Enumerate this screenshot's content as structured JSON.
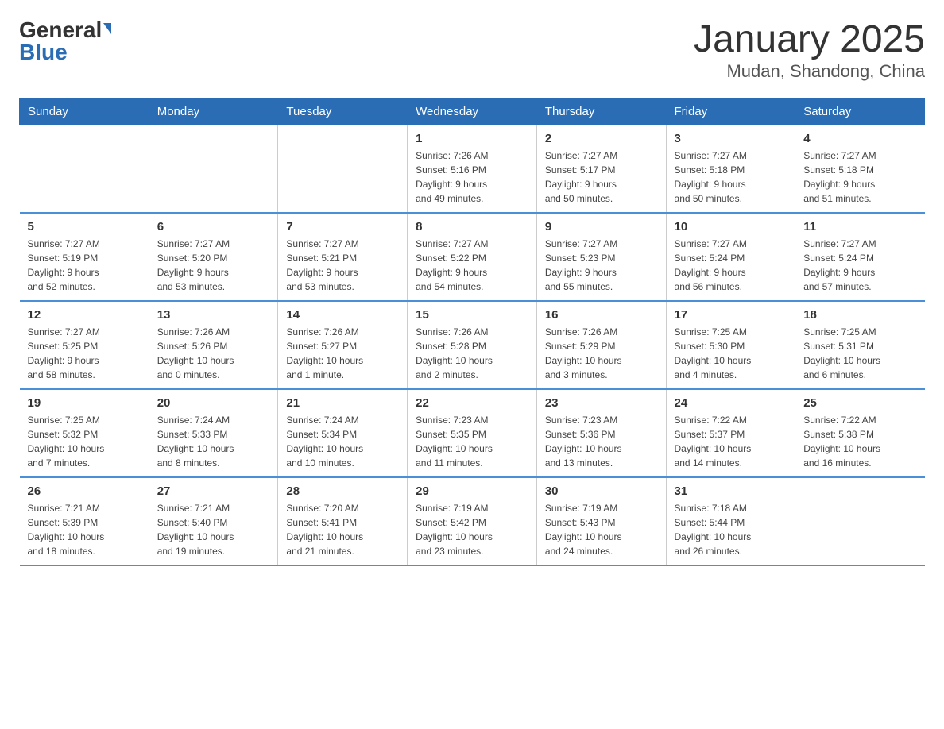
{
  "logo": {
    "general": "General",
    "blue": "Blue"
  },
  "title": "January 2025",
  "subtitle": "Mudan, Shandong, China",
  "weekdays": [
    "Sunday",
    "Monday",
    "Tuesday",
    "Wednesday",
    "Thursday",
    "Friday",
    "Saturday"
  ],
  "weeks": [
    [
      {
        "day": "",
        "info": ""
      },
      {
        "day": "",
        "info": ""
      },
      {
        "day": "",
        "info": ""
      },
      {
        "day": "1",
        "info": "Sunrise: 7:26 AM\nSunset: 5:16 PM\nDaylight: 9 hours\nand 49 minutes."
      },
      {
        "day": "2",
        "info": "Sunrise: 7:27 AM\nSunset: 5:17 PM\nDaylight: 9 hours\nand 50 minutes."
      },
      {
        "day": "3",
        "info": "Sunrise: 7:27 AM\nSunset: 5:18 PM\nDaylight: 9 hours\nand 50 minutes."
      },
      {
        "day": "4",
        "info": "Sunrise: 7:27 AM\nSunset: 5:18 PM\nDaylight: 9 hours\nand 51 minutes."
      }
    ],
    [
      {
        "day": "5",
        "info": "Sunrise: 7:27 AM\nSunset: 5:19 PM\nDaylight: 9 hours\nand 52 minutes."
      },
      {
        "day": "6",
        "info": "Sunrise: 7:27 AM\nSunset: 5:20 PM\nDaylight: 9 hours\nand 53 minutes."
      },
      {
        "day": "7",
        "info": "Sunrise: 7:27 AM\nSunset: 5:21 PM\nDaylight: 9 hours\nand 53 minutes."
      },
      {
        "day": "8",
        "info": "Sunrise: 7:27 AM\nSunset: 5:22 PM\nDaylight: 9 hours\nand 54 minutes."
      },
      {
        "day": "9",
        "info": "Sunrise: 7:27 AM\nSunset: 5:23 PM\nDaylight: 9 hours\nand 55 minutes."
      },
      {
        "day": "10",
        "info": "Sunrise: 7:27 AM\nSunset: 5:24 PM\nDaylight: 9 hours\nand 56 minutes."
      },
      {
        "day": "11",
        "info": "Sunrise: 7:27 AM\nSunset: 5:24 PM\nDaylight: 9 hours\nand 57 minutes."
      }
    ],
    [
      {
        "day": "12",
        "info": "Sunrise: 7:27 AM\nSunset: 5:25 PM\nDaylight: 9 hours\nand 58 minutes."
      },
      {
        "day": "13",
        "info": "Sunrise: 7:26 AM\nSunset: 5:26 PM\nDaylight: 10 hours\nand 0 minutes."
      },
      {
        "day": "14",
        "info": "Sunrise: 7:26 AM\nSunset: 5:27 PM\nDaylight: 10 hours\nand 1 minute."
      },
      {
        "day": "15",
        "info": "Sunrise: 7:26 AM\nSunset: 5:28 PM\nDaylight: 10 hours\nand 2 minutes."
      },
      {
        "day": "16",
        "info": "Sunrise: 7:26 AM\nSunset: 5:29 PM\nDaylight: 10 hours\nand 3 minutes."
      },
      {
        "day": "17",
        "info": "Sunrise: 7:25 AM\nSunset: 5:30 PM\nDaylight: 10 hours\nand 4 minutes."
      },
      {
        "day": "18",
        "info": "Sunrise: 7:25 AM\nSunset: 5:31 PM\nDaylight: 10 hours\nand 6 minutes."
      }
    ],
    [
      {
        "day": "19",
        "info": "Sunrise: 7:25 AM\nSunset: 5:32 PM\nDaylight: 10 hours\nand 7 minutes."
      },
      {
        "day": "20",
        "info": "Sunrise: 7:24 AM\nSunset: 5:33 PM\nDaylight: 10 hours\nand 8 minutes."
      },
      {
        "day": "21",
        "info": "Sunrise: 7:24 AM\nSunset: 5:34 PM\nDaylight: 10 hours\nand 10 minutes."
      },
      {
        "day": "22",
        "info": "Sunrise: 7:23 AM\nSunset: 5:35 PM\nDaylight: 10 hours\nand 11 minutes."
      },
      {
        "day": "23",
        "info": "Sunrise: 7:23 AM\nSunset: 5:36 PM\nDaylight: 10 hours\nand 13 minutes."
      },
      {
        "day": "24",
        "info": "Sunrise: 7:22 AM\nSunset: 5:37 PM\nDaylight: 10 hours\nand 14 minutes."
      },
      {
        "day": "25",
        "info": "Sunrise: 7:22 AM\nSunset: 5:38 PM\nDaylight: 10 hours\nand 16 minutes."
      }
    ],
    [
      {
        "day": "26",
        "info": "Sunrise: 7:21 AM\nSunset: 5:39 PM\nDaylight: 10 hours\nand 18 minutes."
      },
      {
        "day": "27",
        "info": "Sunrise: 7:21 AM\nSunset: 5:40 PM\nDaylight: 10 hours\nand 19 minutes."
      },
      {
        "day": "28",
        "info": "Sunrise: 7:20 AM\nSunset: 5:41 PM\nDaylight: 10 hours\nand 21 minutes."
      },
      {
        "day": "29",
        "info": "Sunrise: 7:19 AM\nSunset: 5:42 PM\nDaylight: 10 hours\nand 23 minutes."
      },
      {
        "day": "30",
        "info": "Sunrise: 7:19 AM\nSunset: 5:43 PM\nDaylight: 10 hours\nand 24 minutes."
      },
      {
        "day": "31",
        "info": "Sunrise: 7:18 AM\nSunset: 5:44 PM\nDaylight: 10 hours\nand 26 minutes."
      },
      {
        "day": "",
        "info": ""
      }
    ]
  ]
}
